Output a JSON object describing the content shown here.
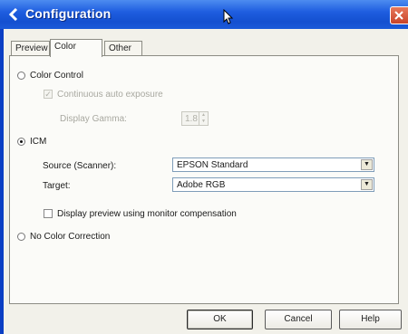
{
  "window": {
    "title": "Configuration"
  },
  "tabs": [
    {
      "label": "Preview",
      "active": false
    },
    {
      "label": "Color",
      "active": true
    },
    {
      "label": "Other",
      "active": false
    }
  ],
  "color_control": {
    "label": "Color Control",
    "selected": false,
    "continuous_auto_exposure": {
      "label": "Continuous auto exposure",
      "checked": true,
      "enabled": false
    },
    "display_gamma": {
      "label": "Display Gamma:",
      "value": "1.8",
      "enabled": false
    }
  },
  "icm": {
    "label": "ICM",
    "selected": true,
    "source": {
      "label": "Source (Scanner):",
      "value": "EPSON Standard"
    },
    "target": {
      "label": "Target:",
      "value": "Adobe RGB"
    },
    "monitor_compensation": {
      "label": "Display preview using monitor compensation",
      "checked": false
    }
  },
  "no_color_correction": {
    "label": "No Color Correction",
    "selected": false
  },
  "buttons": {
    "ok": "OK",
    "cancel": "Cancel",
    "help": "Help"
  },
  "colors": {
    "titlebar": "#1f5ee0",
    "close": "#d0502e",
    "dialog_bg": "#f2f1ea",
    "panel_bg": "#fbfbf8"
  }
}
